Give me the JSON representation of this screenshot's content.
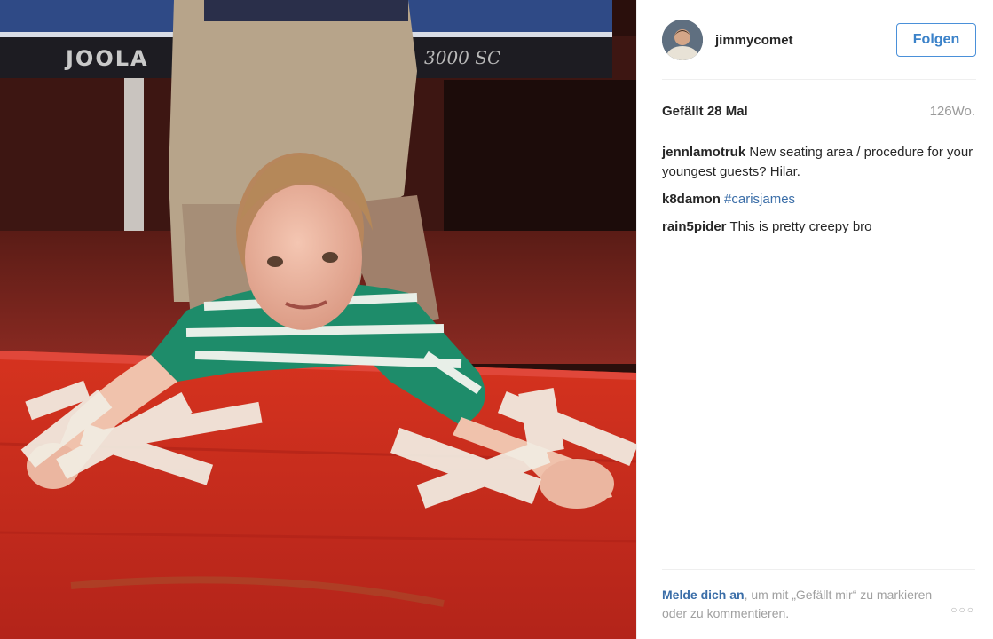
{
  "post": {
    "image_alt": "Toddler taped to a red bench",
    "table_brand": "JOOLA",
    "table_model": "3000 SC"
  },
  "header": {
    "username": "jimmycomet",
    "follow_label": "Folgen"
  },
  "meta": {
    "likes": "Gefällt 28 Mal",
    "time": "126Wo."
  },
  "comments": [
    {
      "user": "jennlamotruk",
      "text": "New seating area / procedure for your youngest guests? Hilar."
    },
    {
      "user": "k8damon",
      "text": "#carisjames"
    },
    {
      "user": "rain5pider",
      "text": "This is pretty creepy bro"
    }
  ],
  "footer": {
    "login_link": "Melde dich an",
    "login_text": ", um mit „Gefällt mir“ zu markieren oder zu kommentieren.",
    "more_icon": "more-options-icon"
  },
  "colors": {
    "link": "#3b6ea8",
    "follow": "#4a90d9",
    "bench": "#c8281c"
  }
}
